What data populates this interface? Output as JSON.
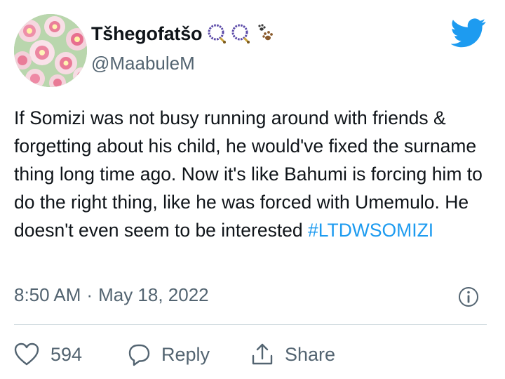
{
  "author": {
    "display_name": "Tšhegofatšo",
    "handle": "@MaabuleM",
    "name_emojis": [
      "prayer-beads-icon",
      "prayer-beads-icon",
      "paw-prints-icon"
    ]
  },
  "tweet": {
    "text": "If Somizi was not busy running around with friends & forgetting about his child, he would've fixed the surname thing long time ago. Now it's like Bahumi is forcing him to do the right thing, like he was forced with Umemulo. He doesn't even seem to be interested ",
    "hashtag": "#LTDWSOMIZI",
    "time": "8:50 AM",
    "separator": "·",
    "date": "May 18, 2022"
  },
  "actions": {
    "like_count": "594",
    "reply_label": "Reply",
    "share_label": "Share"
  },
  "colors": {
    "brand_blue": "#1d9bf0",
    "text_primary": "#0f1419",
    "text_secondary": "#536471",
    "divider": "#cfd9de"
  }
}
